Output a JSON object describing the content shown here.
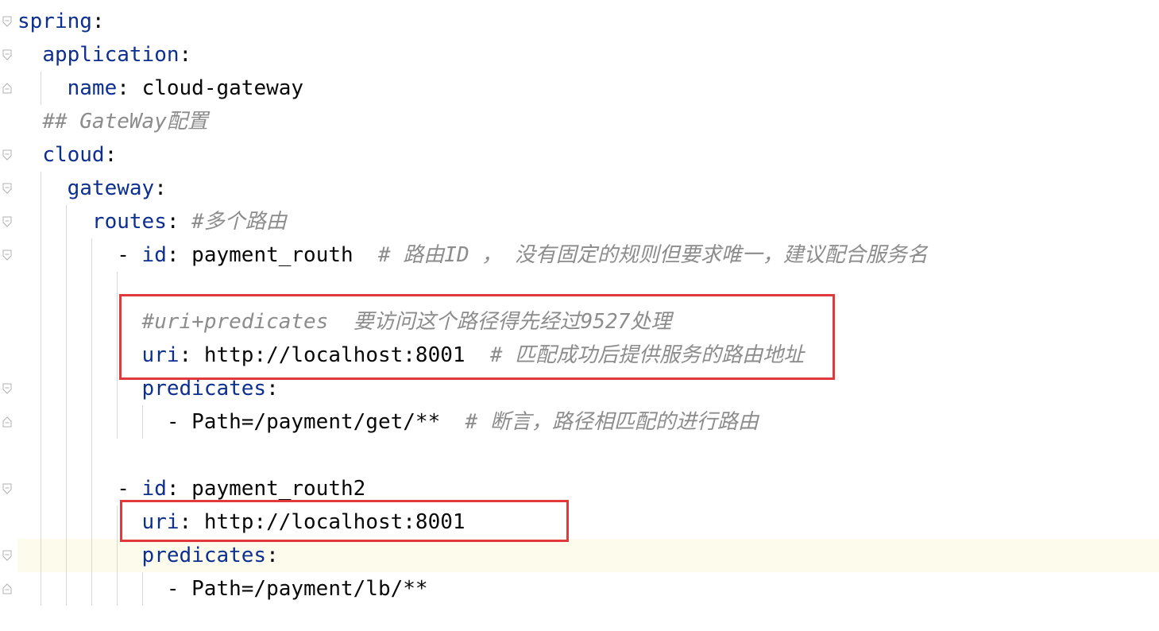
{
  "editor": {
    "lines": [
      {
        "indent": "",
        "key": "spring",
        "sep": ":",
        "value": "",
        "comment": ""
      },
      {
        "indent": "  ",
        "key": "application",
        "sep": ":",
        "value": "",
        "comment": ""
      },
      {
        "indent": "    ",
        "key": "name",
        "sep": ": ",
        "value": "cloud-gateway",
        "comment": ""
      },
      {
        "indent": "  ",
        "key": "",
        "sep": "",
        "value": "",
        "comment": "## GateWay配置"
      },
      {
        "indent": "  ",
        "key": "cloud",
        "sep": ":",
        "value": "",
        "comment": ""
      },
      {
        "indent": "    ",
        "key": "gateway",
        "sep": ":",
        "value": "",
        "comment": ""
      },
      {
        "indent": "      ",
        "key": "routes",
        "sep": ": ",
        "value": "",
        "comment": "#多个路由"
      },
      {
        "indent": "        - ",
        "key": "id",
        "sep": ": ",
        "value": "payment_routh  ",
        "comment": "# 路由ID ， 没有固定的规则但要求唯一，建议配合服务名"
      },
      {
        "indent": "",
        "key": "",
        "sep": "",
        "value": "",
        "comment": ""
      },
      {
        "indent": "          ",
        "key": "",
        "sep": "",
        "value": "",
        "comment": "#uri+predicates  要访问这个路径得先经过9527处理"
      },
      {
        "indent": "          ",
        "key": "uri",
        "sep": ": ",
        "value": "http://localhost:8001  ",
        "comment": "# 匹配成功后提供服务的路由地址"
      },
      {
        "indent": "          ",
        "key": "predicates",
        "sep": ":",
        "value": "",
        "comment": ""
      },
      {
        "indent": "            ",
        "key": "",
        "sep": "",
        "value": "- Path=/payment/get/**  ",
        "comment": "# 断言，路径相匹配的进行路由"
      },
      {
        "indent": "",
        "key": "",
        "sep": "",
        "value": "",
        "comment": ""
      },
      {
        "indent": "        - ",
        "key": "id",
        "sep": ": ",
        "value": "payment_routh2",
        "comment": ""
      },
      {
        "indent": "          ",
        "key": "uri",
        "sep": ": ",
        "value": "http://localhost:8001",
        "comment": ""
      },
      {
        "indent": "          ",
        "key": "predicates",
        "sep": ":",
        "value": "",
        "comment": ""
      },
      {
        "indent": "            ",
        "key": "",
        "sep": "",
        "value": "- Path=/payment/lb/**",
        "comment": ""
      }
    ]
  },
  "highlight_color": "#e2393c",
  "current_line_color": "#fdfbec",
  "key_color": "#0d2f8f",
  "comment_color": "#8c8c8c"
}
